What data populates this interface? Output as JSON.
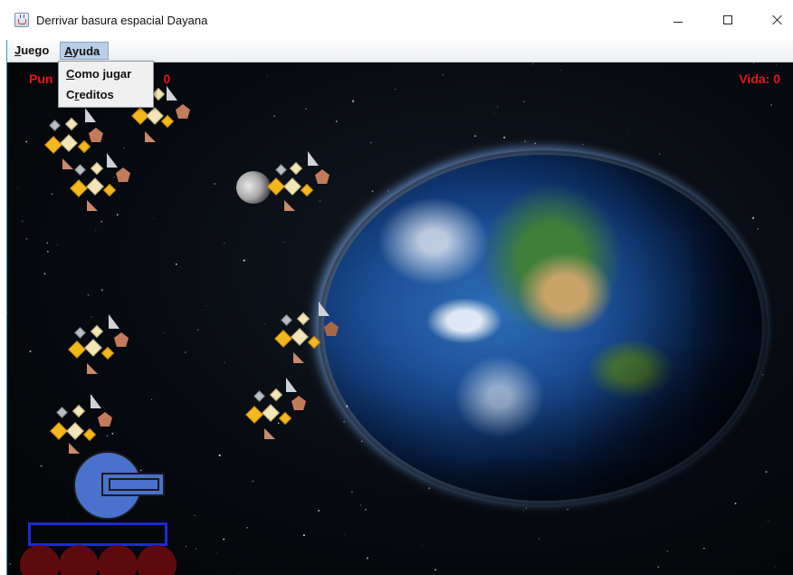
{
  "window": {
    "title": "Derrivar basura espacial Dayana"
  },
  "menu": {
    "juego": "Juego",
    "ayuda": "Ayuda",
    "juego_mnemonic": "J",
    "juego_rest": "uego",
    "ayuda_mnemonic": "A",
    "ayuda_rest": "yuda"
  },
  "ayuda_dropdown": {
    "items": [
      {
        "label": "Como jugar",
        "mnemonic": "C",
        "rest": "omo jugar"
      },
      {
        "label": "Creditos",
        "mnemonic_prefix": "C",
        "mnemonic": "r",
        "rest": "editos"
      }
    ]
  },
  "hud": {
    "score_partial": "Pun",
    "score_tail": "0",
    "life": "Vida: 0"
  },
  "colors": {
    "hud_text": "#e8141b",
    "tank": "#4a72cc",
    "platform": "#1a2bd8",
    "wheels": "#5e0a0c",
    "menu_highlight": "#b8cfe5"
  },
  "icons": {
    "app": "java-coffee-cup-icon",
    "minimize": "minimize-icon",
    "maximize": "maximize-icon",
    "close": "close-icon"
  }
}
